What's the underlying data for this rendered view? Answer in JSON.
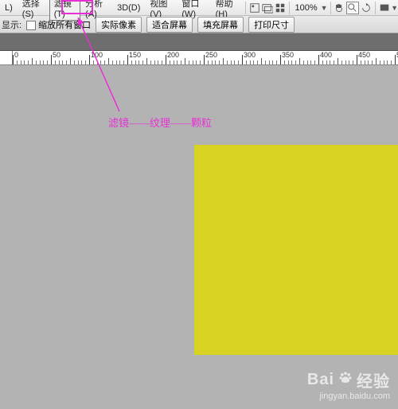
{
  "menu": {
    "items": [
      "L)",
      "选择(S)",
      "滤镜(T)",
      "分析(A)",
      "3D(D)",
      "视图(V)",
      "窗口(W)",
      "帮助(H)"
    ],
    "highlight_index": 2,
    "zoom": "100%"
  },
  "options": {
    "label_hint": "显示:",
    "check_label": "缩放所有窗口",
    "btn1": "实际像素",
    "btn2": "适合屏幕",
    "btn3": "填充屏幕",
    "btn4": "打印尺寸"
  },
  "ruler": {
    "start": 0,
    "step": 50,
    "count": 11
  },
  "annotation": {
    "text": "滤镜——纹理——颗粒"
  },
  "canvas": {
    "fill": "#d8d321"
  },
  "watermark": {
    "brand_a": "Bai",
    "brand_b": "经验",
    "url": "jingyan.baidu.com"
  }
}
